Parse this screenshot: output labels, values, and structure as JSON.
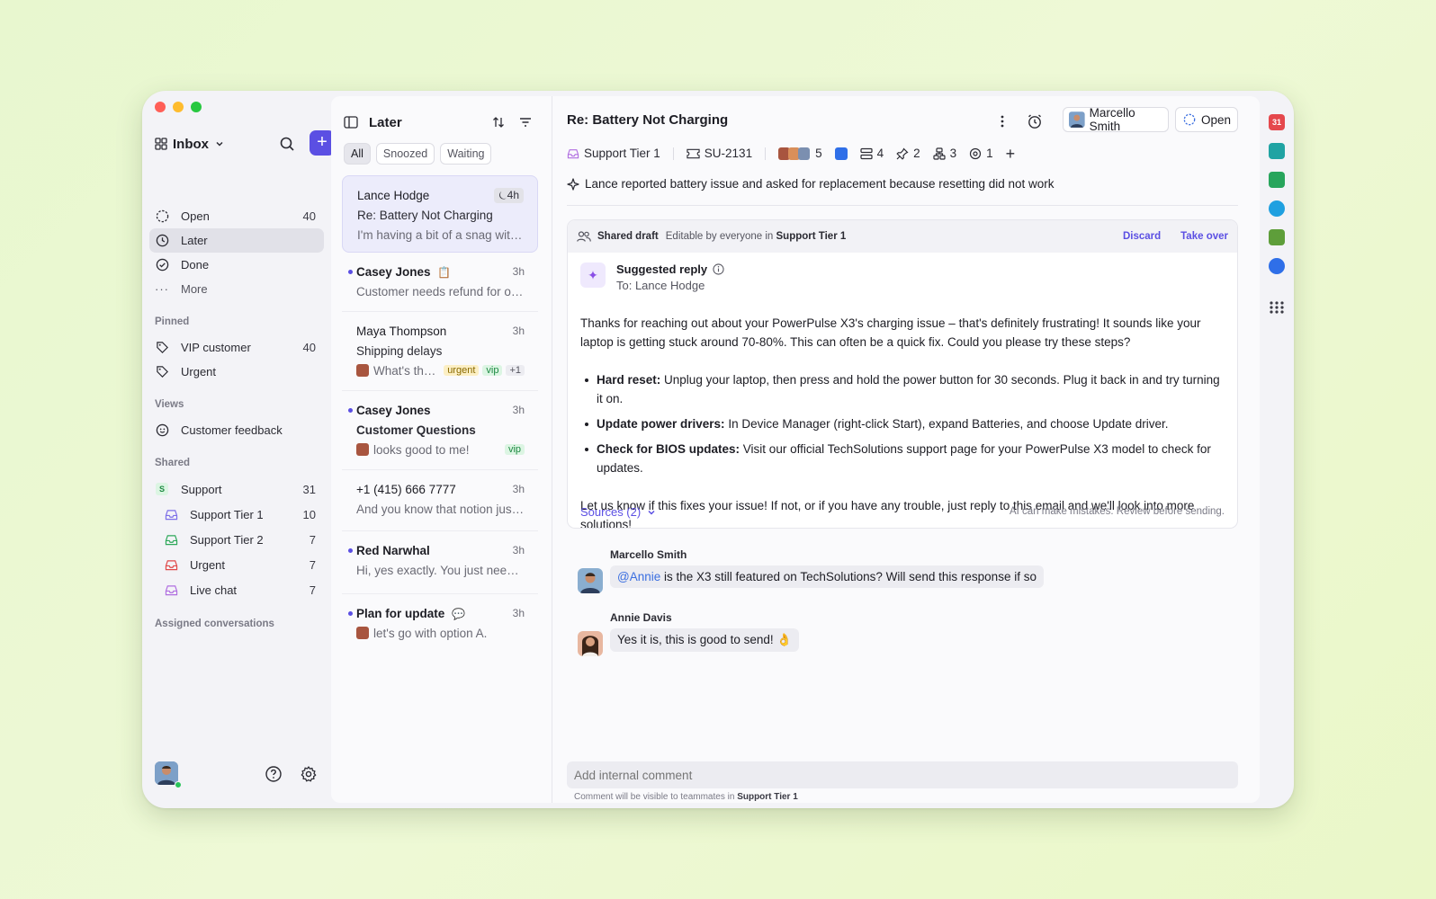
{
  "sidebar": {
    "inbox_label": "Inbox",
    "nav": [
      {
        "label": "Open",
        "count": "40",
        "icon": "open-circle-icon"
      },
      {
        "label": "Later",
        "count": "",
        "icon": "clock-icon"
      },
      {
        "label": "Done",
        "count": "",
        "icon": "check-circle-icon"
      },
      {
        "label": "More",
        "count": "",
        "icon": "more-dots-icon"
      }
    ],
    "pinned_title": "Pinned",
    "pinned": [
      {
        "label": "VIP customer",
        "count": "40"
      },
      {
        "label": "Urgent",
        "count": ""
      }
    ],
    "views_title": "Views",
    "views": [
      {
        "label": "Customer feedback"
      }
    ],
    "shared_title": "Shared",
    "shared": [
      {
        "label": "Support",
        "count": "31",
        "badge": "S"
      },
      {
        "label": "Support Tier 1",
        "count": "10"
      },
      {
        "label": "Support Tier 2",
        "count": "7"
      },
      {
        "label": "Urgent",
        "count": "7"
      },
      {
        "label": "Live chat",
        "count": "7"
      }
    ],
    "assigned_title": "Assigned conversations"
  },
  "list": {
    "title": "Later",
    "chips": [
      "All",
      "Snoozed",
      "Waiting"
    ],
    "conversations": [
      {
        "name": "Lance Hodge",
        "time": "4h",
        "subject": "Re: Battery Not Charging",
        "preview": "I'm having a bit of a snag with..."
      },
      {
        "name": "Casey Jones",
        "time": "3h",
        "preview": "Customer needs refund for ord..."
      },
      {
        "name": "Maya Thompson",
        "time": "3h",
        "subject": "Shipping delays",
        "preview": "What's the...",
        "tags": [
          "urgent",
          "vip",
          "+1"
        ]
      },
      {
        "name": "Casey Jones",
        "time": "3h",
        "subject": "Customer Questions",
        "preview": "looks good to me!",
        "tags": [
          "vip"
        ]
      },
      {
        "name": "+1 (415) 666 7777",
        "time": "3h",
        "preview": "And you know that notion just..."
      },
      {
        "name": "Red Narwhal",
        "time": "3h",
        "preview": "Hi, yes exactly. You just need t..."
      },
      {
        "name": "Plan for update",
        "time": "3h",
        "preview": "let's go with option A."
      }
    ]
  },
  "main": {
    "title": "Re: Battery Not Charging",
    "assignee": "Marcello Smith",
    "status": "Open",
    "meta": {
      "inbox": "Support Tier 1",
      "ticket": "SU-2131",
      "participants": "5",
      "stack": "4",
      "pins": "2",
      "links": "3",
      "targets": "1"
    },
    "summary": "Lance reported battery issue and asked for replacement because resetting did not work",
    "draft": {
      "label": "Shared draft",
      "editable_prefix": "Editable by everyone in",
      "editable_team": "Support Tier 1",
      "discard": "Discard",
      "take_over": "Take over",
      "suggested": "Suggested reply",
      "to": "To: Lance Hodge",
      "p1": "Thanks for reaching out about your PowerPulse X3's charging issue – that's definitely frustrating! It sounds like your laptop is getting stuck around 70-80%. This can often be a quick fix. Could you please try these steps?",
      "b1_title": "Hard reset:",
      "b1": "Unplug your laptop, then press and hold the power button for 30 seconds. Plug it back in and try turning it on.",
      "b2_title": "Update power drivers:",
      "b2": "In Device Manager (right-click Start), expand Batteries, and choose Update driver.",
      "b3_title": "Check for BIOS updates:",
      "b3": "Visit our official TechSolutions support page for your PowerPulse X3 model to check for updates.",
      "p2": "Let us know if this fixes your issue! If not, or if you have any trouble, just reply to this email and we'll look into more solutions!",
      "sources": "Sources (2)",
      "disclaimer": "AI can make mistakes. Review before sending."
    },
    "comments": [
      {
        "name": "Marcello Smith",
        "mention": "@Annie",
        "text": " is the X3 still featured on TechSolutions? Will send this response if so"
      },
      {
        "name": "Annie Davis",
        "mention": "",
        "text": "Yes it is, this is good to send! 👌"
      }
    ],
    "comment_placeholder": "Add internal comment",
    "comment_note_prefix": "Comment will be visible to teammates in",
    "comment_note_team": "Support Tier 1"
  },
  "colors": {
    "accent": "#5b4fe3",
    "selected": "#ececfb"
  }
}
